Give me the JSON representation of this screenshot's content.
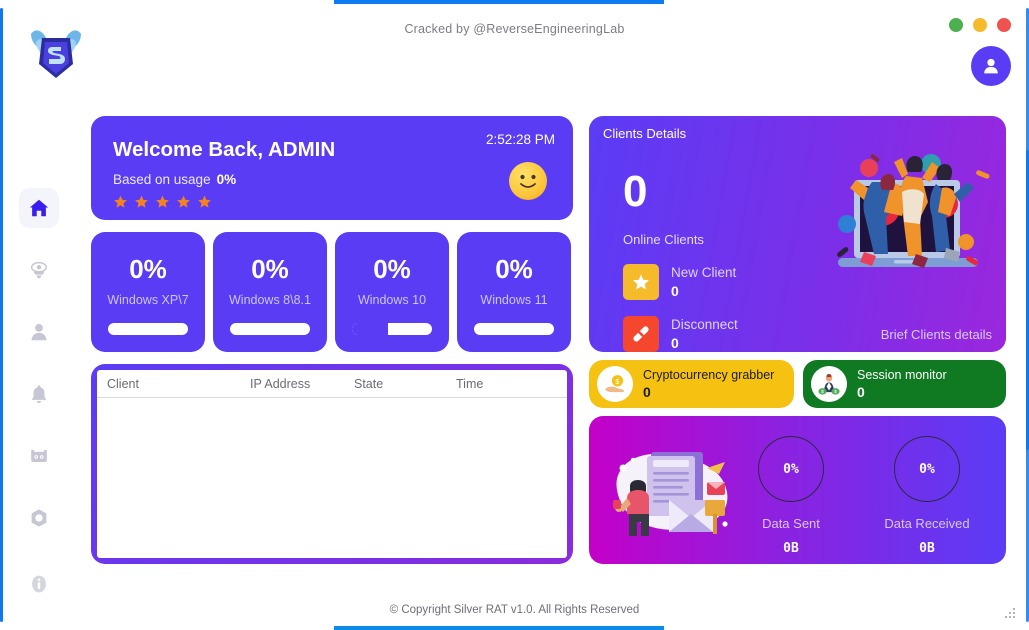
{
  "window": {
    "cracked_by": "Cracked by @ReverseEngineeringLab",
    "logo_icon": "silver-rat-wings-logo",
    "avatar_icon": "user-avatar-icon",
    "buttons": [
      {
        "name": "minimize",
        "color": "#4caf50"
      },
      {
        "name": "maximize",
        "color": "#f5bb2b"
      },
      {
        "name": "close",
        "color": "#ef5350"
      }
    ]
  },
  "sidebar": {
    "items": [
      {
        "icon": "home-icon",
        "name": "home",
        "active": true
      },
      {
        "icon": "eye-icon",
        "name": "surveillance",
        "active": false
      },
      {
        "icon": "user-icon",
        "name": "clients",
        "active": false
      },
      {
        "icon": "bell-icon",
        "name": "notifications",
        "active": false
      },
      {
        "icon": "robot-icon",
        "name": "builder",
        "active": false
      },
      {
        "icon": "gear-icon",
        "name": "settings",
        "active": false
      }
    ],
    "info": {
      "icon": "info-icon",
      "name": "about"
    }
  },
  "welcome": {
    "title": "Welcome Back, ADMIN",
    "subtitle": "Based on usage",
    "usage_pct": "0%",
    "time": "2:52:28 PM",
    "stars": 5,
    "star_color": "#f58220",
    "emoji_icon": "smiley-face-icon",
    "bg": "#5b3cf5"
  },
  "os_stats": [
    {
      "pct": "0%",
      "label": "Windows XP\\7",
      "fill": 0
    },
    {
      "pct": "0%",
      "label": "Windows 8\\8.1",
      "fill": 0
    },
    {
      "pct": "0%",
      "label": "Windows 10",
      "fill": 45
    },
    {
      "pct": "0%",
      "label": "Windows 11",
      "fill": 0
    }
  ],
  "clients_table": {
    "columns": [
      "Client",
      "IP Address",
      "State",
      "Time"
    ],
    "rows": []
  },
  "clients_details": {
    "title": "Clients Details",
    "count": "0",
    "count_label": "Online Clients",
    "brief": "Brief Clients details",
    "illustration_icon": "people-celebrating-laptop-illustration",
    "stats": [
      {
        "name": "New Client",
        "value": "0",
        "icon": "star-icon",
        "color": "#f5bb2b"
      },
      {
        "name": "Disconnect",
        "value": "0",
        "icon": "unplug-icon",
        "color": "#f4472e"
      }
    ]
  },
  "modules": [
    {
      "name": "Cryptocurrency grabber",
      "value": "0",
      "icon": "coin-hand-icon",
      "bg": "#f5c211"
    },
    {
      "name": "Session monitor",
      "value": "0",
      "icon": "money-person-icon",
      "bg": "#0f7a22"
    }
  ],
  "data_panel": {
    "illustration_icon": "person-mail-document-illustration",
    "gauges": [
      {
        "pct": "0%",
        "name": "Data Sent",
        "value": "0B"
      },
      {
        "pct": "0%",
        "name": "Data Received",
        "value": "0B"
      }
    ]
  },
  "footer": {
    "copyright": "© Copyright Silver RAT v1.0. All Rights Reserved",
    "resize_grip_icon": "resize-grip-icon"
  }
}
